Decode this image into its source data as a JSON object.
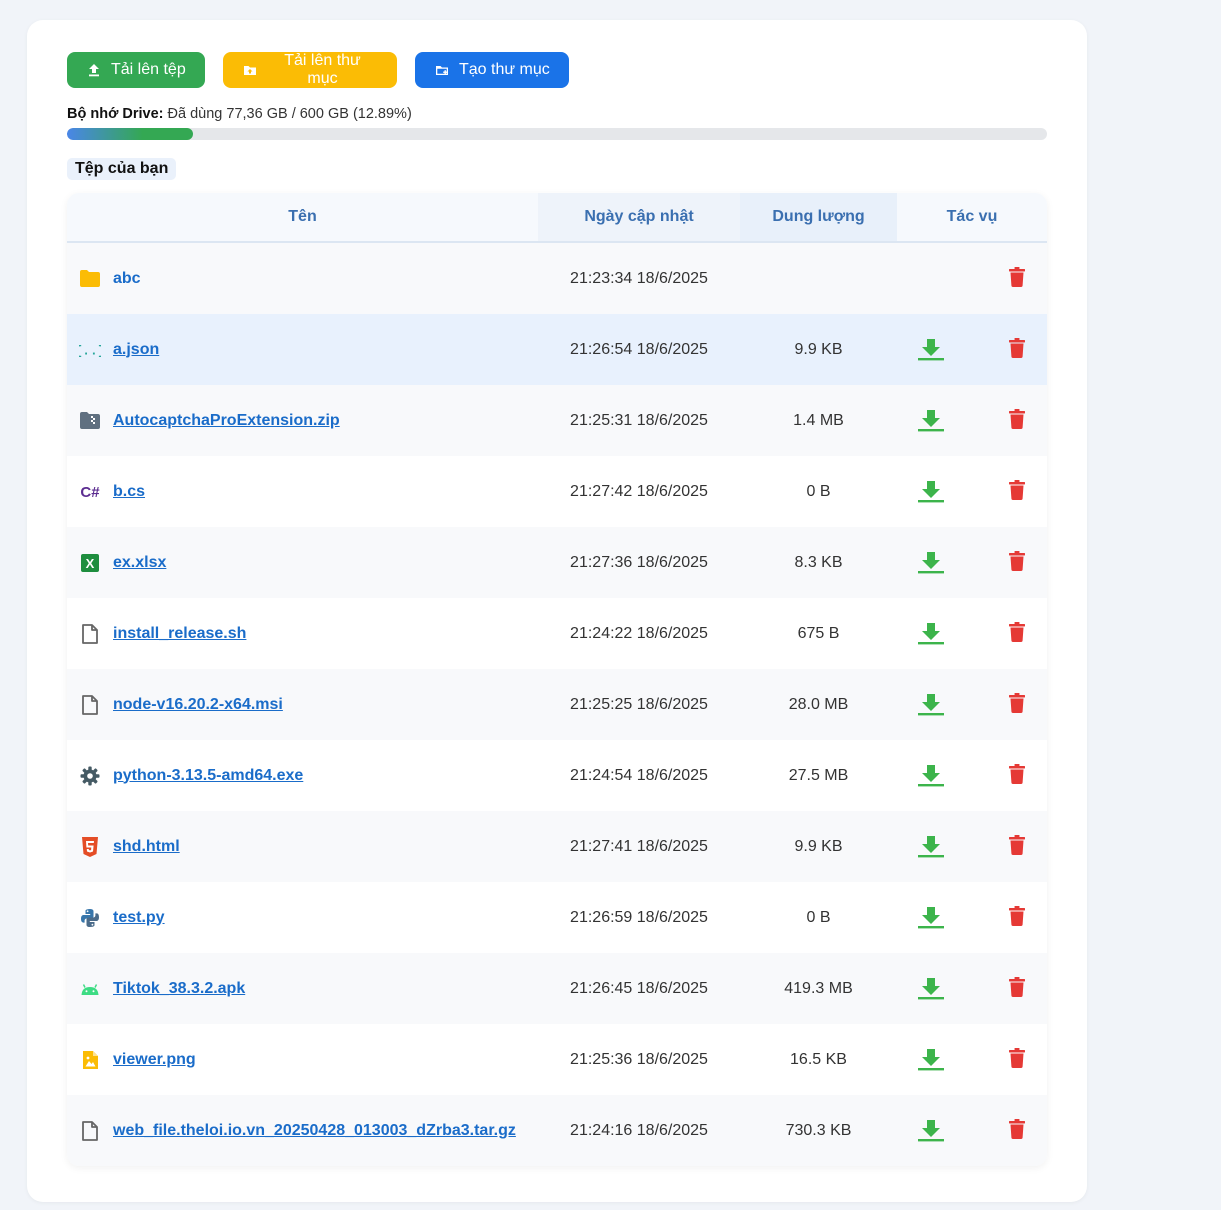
{
  "toolbar": {
    "upload_file": "Tải lên tệp",
    "upload_folder": "Tải lên thư mục",
    "create_folder": "Tạo thư mục"
  },
  "storage": {
    "label": "Bộ nhớ Drive:",
    "text": "Đã dùng 77,36 GB / 600 GB (12.89%)",
    "percent": 12.89
  },
  "section_title": "Tệp của bạn",
  "table": {
    "headers": {
      "name": "Tên",
      "date": "Ngày cập nhật",
      "size": "Dung lượng",
      "actions": "Tác vụ"
    },
    "rows": [
      {
        "name": "abc",
        "date": "21:23:34 18/6/2025",
        "size": "",
        "icon": "folder-icon"
      },
      {
        "name": "a.json",
        "date": "21:26:54 18/6/2025",
        "size": "9.9 KB",
        "icon": "json-icon"
      },
      {
        "name": "AutocaptchaProExtension.zip",
        "date": "21:25:31 18/6/2025",
        "size": "1.4 MB",
        "icon": "zip-folder-icon"
      },
      {
        "name": "b.cs",
        "date": "21:27:42 18/6/2025",
        "size": "0 B",
        "icon": "csharp-icon"
      },
      {
        "name": "ex.xlsx",
        "date": "21:27:36 18/6/2025",
        "size": "8.3 KB",
        "icon": "excel-icon"
      },
      {
        "name": "install_release.sh",
        "date": "21:24:22 18/6/2025",
        "size": "675 B",
        "icon": "file-icon"
      },
      {
        "name": "node-v16.20.2-x64.msi",
        "date": "21:25:25 18/6/2025",
        "size": "28.0 MB",
        "icon": "file-icon"
      },
      {
        "name": "python-3.13.5-amd64.exe",
        "date": "21:24:54 18/6/2025",
        "size": "27.5 MB",
        "icon": "gear-icon"
      },
      {
        "name": "shd.html",
        "date": "21:27:41 18/6/2025",
        "size": "9.9 KB",
        "icon": "html5-icon"
      },
      {
        "name": "test.py",
        "date": "21:26:59 18/6/2025",
        "size": "0 B",
        "icon": "python-icon"
      },
      {
        "name": "Tiktok_38.3.2.apk",
        "date": "21:26:45 18/6/2025",
        "size": "419.3 MB",
        "icon": "android-icon"
      },
      {
        "name": "viewer.png",
        "date": "21:25:36 18/6/2025",
        "size": "16.5 KB",
        "icon": "image-icon"
      },
      {
        "name": "web_file.theloi.io.vn_20250428_013003_dZrba3.tar.gz",
        "date": "21:24:16 18/6/2025",
        "size": "730.3 KB",
        "icon": "file-icon"
      }
    ]
  },
  "colors": {
    "green": "#34a853",
    "yellow": "#fbbc05",
    "blue": "#1a73e8",
    "link": "#1a6cc9",
    "delete": "#e53935",
    "download": "#3cb44b"
  }
}
